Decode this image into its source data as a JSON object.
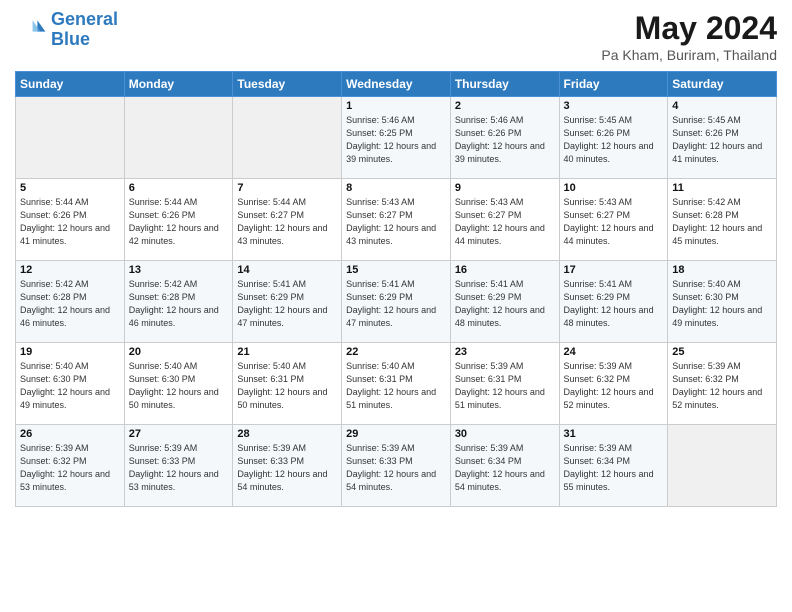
{
  "header": {
    "logo_line1": "General",
    "logo_line2": "Blue",
    "month_title": "May 2024",
    "location": "Pa Kham, Buriram, Thailand"
  },
  "days_of_week": [
    "Sunday",
    "Monday",
    "Tuesday",
    "Wednesday",
    "Thursday",
    "Friday",
    "Saturday"
  ],
  "weeks": [
    [
      {
        "day": "",
        "empty": true
      },
      {
        "day": "",
        "empty": true
      },
      {
        "day": "",
        "empty": true
      },
      {
        "day": "1",
        "sunrise": "5:46 AM",
        "sunset": "6:25 PM",
        "daylight": "12 hours and 39 minutes."
      },
      {
        "day": "2",
        "sunrise": "5:46 AM",
        "sunset": "6:26 PM",
        "daylight": "12 hours and 39 minutes."
      },
      {
        "day": "3",
        "sunrise": "5:45 AM",
        "sunset": "6:26 PM",
        "daylight": "12 hours and 40 minutes."
      },
      {
        "day": "4",
        "sunrise": "5:45 AM",
        "sunset": "6:26 PM",
        "daylight": "12 hours and 41 minutes."
      }
    ],
    [
      {
        "day": "5",
        "sunrise": "5:44 AM",
        "sunset": "6:26 PM",
        "daylight": "12 hours and 41 minutes."
      },
      {
        "day": "6",
        "sunrise": "5:44 AM",
        "sunset": "6:26 PM",
        "daylight": "12 hours and 42 minutes."
      },
      {
        "day": "7",
        "sunrise": "5:44 AM",
        "sunset": "6:27 PM",
        "daylight": "12 hours and 43 minutes."
      },
      {
        "day": "8",
        "sunrise": "5:43 AM",
        "sunset": "6:27 PM",
        "daylight": "12 hours and 43 minutes."
      },
      {
        "day": "9",
        "sunrise": "5:43 AM",
        "sunset": "6:27 PM",
        "daylight": "12 hours and 44 minutes."
      },
      {
        "day": "10",
        "sunrise": "5:43 AM",
        "sunset": "6:27 PM",
        "daylight": "12 hours and 44 minutes."
      },
      {
        "day": "11",
        "sunrise": "5:42 AM",
        "sunset": "6:28 PM",
        "daylight": "12 hours and 45 minutes."
      }
    ],
    [
      {
        "day": "12",
        "sunrise": "5:42 AM",
        "sunset": "6:28 PM",
        "daylight": "12 hours and 46 minutes."
      },
      {
        "day": "13",
        "sunrise": "5:42 AM",
        "sunset": "6:28 PM",
        "daylight": "12 hours and 46 minutes."
      },
      {
        "day": "14",
        "sunrise": "5:41 AM",
        "sunset": "6:29 PM",
        "daylight": "12 hours and 47 minutes."
      },
      {
        "day": "15",
        "sunrise": "5:41 AM",
        "sunset": "6:29 PM",
        "daylight": "12 hours and 47 minutes."
      },
      {
        "day": "16",
        "sunrise": "5:41 AM",
        "sunset": "6:29 PM",
        "daylight": "12 hours and 48 minutes."
      },
      {
        "day": "17",
        "sunrise": "5:41 AM",
        "sunset": "6:29 PM",
        "daylight": "12 hours and 48 minutes."
      },
      {
        "day": "18",
        "sunrise": "5:40 AM",
        "sunset": "6:30 PM",
        "daylight": "12 hours and 49 minutes."
      }
    ],
    [
      {
        "day": "19",
        "sunrise": "5:40 AM",
        "sunset": "6:30 PM",
        "daylight": "12 hours and 49 minutes."
      },
      {
        "day": "20",
        "sunrise": "5:40 AM",
        "sunset": "6:30 PM",
        "daylight": "12 hours and 50 minutes."
      },
      {
        "day": "21",
        "sunrise": "5:40 AM",
        "sunset": "6:31 PM",
        "daylight": "12 hours and 50 minutes."
      },
      {
        "day": "22",
        "sunrise": "5:40 AM",
        "sunset": "6:31 PM",
        "daylight": "12 hours and 51 minutes."
      },
      {
        "day": "23",
        "sunrise": "5:39 AM",
        "sunset": "6:31 PM",
        "daylight": "12 hours and 51 minutes."
      },
      {
        "day": "24",
        "sunrise": "5:39 AM",
        "sunset": "6:32 PM",
        "daylight": "12 hours and 52 minutes."
      },
      {
        "day": "25",
        "sunrise": "5:39 AM",
        "sunset": "6:32 PM",
        "daylight": "12 hours and 52 minutes."
      }
    ],
    [
      {
        "day": "26",
        "sunrise": "5:39 AM",
        "sunset": "6:32 PM",
        "daylight": "12 hours and 53 minutes."
      },
      {
        "day": "27",
        "sunrise": "5:39 AM",
        "sunset": "6:33 PM",
        "daylight": "12 hours and 53 minutes."
      },
      {
        "day": "28",
        "sunrise": "5:39 AM",
        "sunset": "6:33 PM",
        "daylight": "12 hours and 54 minutes."
      },
      {
        "day": "29",
        "sunrise": "5:39 AM",
        "sunset": "6:33 PM",
        "daylight": "12 hours and 54 minutes."
      },
      {
        "day": "30",
        "sunrise": "5:39 AM",
        "sunset": "6:34 PM",
        "daylight": "12 hours and 54 minutes."
      },
      {
        "day": "31",
        "sunrise": "5:39 AM",
        "sunset": "6:34 PM",
        "daylight": "12 hours and 55 minutes."
      },
      {
        "day": "",
        "empty": true
      }
    ]
  ]
}
